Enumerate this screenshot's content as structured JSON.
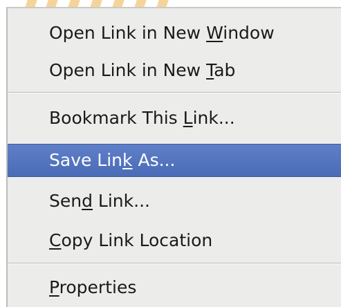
{
  "menu": {
    "items": [
      {
        "pre": "Open Link in New ",
        "key": "W",
        "post": "indow",
        "selected": false
      },
      {
        "pre": "Open Link in New ",
        "key": "T",
        "post": "ab",
        "selected": false
      },
      {
        "pre": "Bookmark This ",
        "key": "L",
        "post": "ink...",
        "selected": false
      },
      {
        "pre": "Save Lin",
        "key": "k",
        "post": " As...",
        "selected": true
      },
      {
        "pre": "Sen",
        "key": "d",
        "post": " Link...",
        "selected": false
      },
      {
        "pre": "",
        "key": "C",
        "post": "opy Link Location",
        "selected": false
      },
      {
        "pre": "",
        "key": "P",
        "post": "roperties",
        "selected": false
      }
    ]
  },
  "colors": {
    "menu_bg": "#ececeb",
    "selection": "#4a6bb7",
    "selection_text": "#ffffff",
    "text": "#1a1a1a",
    "background_stripes": "#f3cd8a"
  }
}
